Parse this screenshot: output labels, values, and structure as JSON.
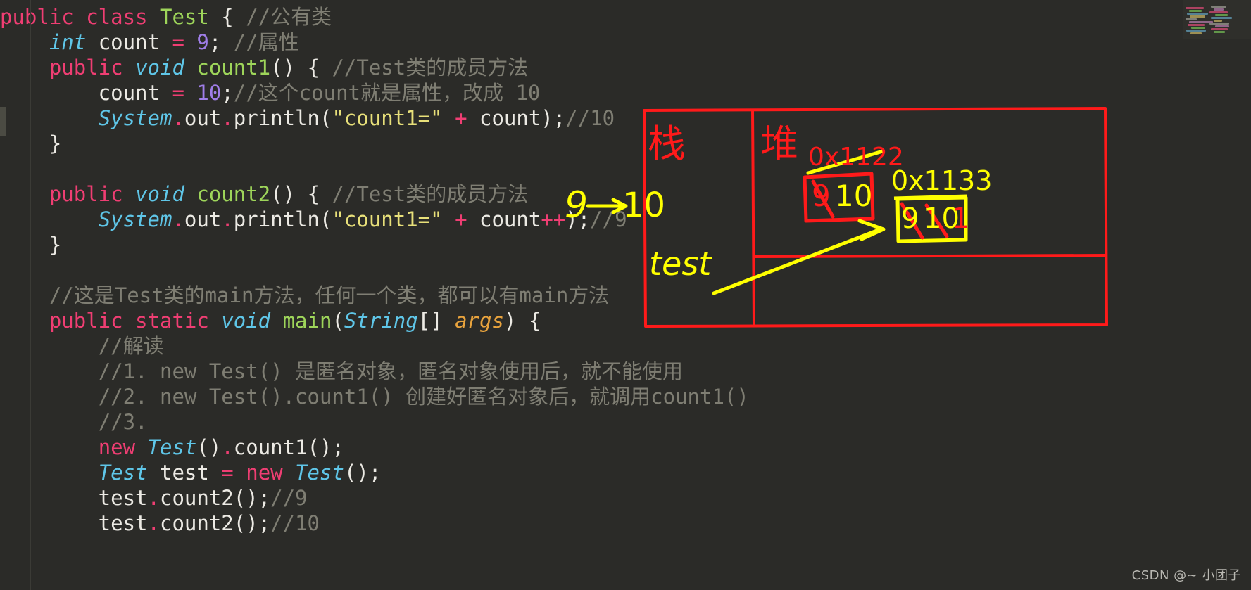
{
  "editor": {
    "background": "#2b2b28",
    "lines": [
      [
        {
          "t": "public class ",
          "c": "kw"
        },
        {
          "t": "Test",
          "c": "cls"
        },
        {
          "t": " { ",
          "c": "plain"
        },
        {
          "t": "//公有类",
          "c": "cmt"
        }
      ],
      [
        {
          "t": "    ",
          "c": "plain"
        },
        {
          "t": "int",
          "c": "type"
        },
        {
          "t": " count ",
          "c": "plain"
        },
        {
          "t": "=",
          "c": "op"
        },
        {
          "t": " ",
          "c": "plain"
        },
        {
          "t": "9",
          "c": "num"
        },
        {
          "t": "; ",
          "c": "plain"
        },
        {
          "t": "//属性",
          "c": "cmt"
        }
      ],
      [
        {
          "t": "    ",
          "c": "plain"
        },
        {
          "t": "public ",
          "c": "kw"
        },
        {
          "t": "void",
          "c": "type"
        },
        {
          "t": " ",
          "c": "plain"
        },
        {
          "t": "count1",
          "c": "cls"
        },
        {
          "t": "() { ",
          "c": "plain"
        },
        {
          "t": "//Test类的成员方法",
          "c": "cmt"
        }
      ],
      [
        {
          "t": "        count ",
          "c": "plain"
        },
        {
          "t": "=",
          "c": "op"
        },
        {
          "t": " ",
          "c": "plain"
        },
        {
          "t": "10",
          "c": "num"
        },
        {
          "t": ";",
          "c": "plain"
        },
        {
          "t": "//这个count就是属性，改成 10",
          "c": "cmt"
        }
      ],
      [
        {
          "t": "        ",
          "c": "plain"
        },
        {
          "t": "System",
          "c": "type"
        },
        {
          "t": ".",
          "c": "op"
        },
        {
          "t": "out",
          "c": "plain"
        },
        {
          "t": ".",
          "c": "op"
        },
        {
          "t": "println(",
          "c": "plain"
        },
        {
          "t": "\"count1=\"",
          "c": "str"
        },
        {
          "t": " ",
          "c": "plain"
        },
        {
          "t": "+",
          "c": "op"
        },
        {
          "t": " count);",
          "c": "plain"
        },
        {
          "t": "//10",
          "c": "cmt"
        }
      ],
      [
        {
          "t": "    }",
          "c": "plain"
        }
      ],
      [
        {
          "t": "",
          "c": "plain"
        }
      ],
      [
        {
          "t": "    ",
          "c": "plain"
        },
        {
          "t": "public ",
          "c": "kw"
        },
        {
          "t": "void",
          "c": "type"
        },
        {
          "t": " ",
          "c": "plain"
        },
        {
          "t": "count2",
          "c": "cls"
        },
        {
          "t": "() { ",
          "c": "plain"
        },
        {
          "t": "//Test类的成员方法",
          "c": "cmt"
        }
      ],
      [
        {
          "t": "        ",
          "c": "plain"
        },
        {
          "t": "System",
          "c": "type"
        },
        {
          "t": ".",
          "c": "op"
        },
        {
          "t": "out",
          "c": "plain"
        },
        {
          "t": ".",
          "c": "op"
        },
        {
          "t": "println(",
          "c": "plain"
        },
        {
          "t": "\"count1=\"",
          "c": "str"
        },
        {
          "t": " ",
          "c": "plain"
        },
        {
          "t": "+",
          "c": "op"
        },
        {
          "t": " count",
          "c": "plain"
        },
        {
          "t": "++",
          "c": "op"
        },
        {
          "t": ");",
          "c": "plain"
        },
        {
          "t": "//9",
          "c": "cmt"
        }
      ],
      [
        {
          "t": "    }",
          "c": "plain"
        }
      ],
      [
        {
          "t": "",
          "c": "plain"
        }
      ],
      [
        {
          "t": "    ",
          "c": "plain"
        },
        {
          "t": "//这是Test类的main方法，任何一个类，都可以有main方法",
          "c": "cmt"
        }
      ],
      [
        {
          "t": "    ",
          "c": "plain"
        },
        {
          "t": "public static ",
          "c": "kw"
        },
        {
          "t": "void",
          "c": "type"
        },
        {
          "t": " ",
          "c": "plain"
        },
        {
          "t": "main",
          "c": "cls"
        },
        {
          "t": "(",
          "c": "plain"
        },
        {
          "t": "String",
          "c": "type"
        },
        {
          "t": "[] ",
          "c": "plain"
        },
        {
          "t": "args",
          "c": "param"
        },
        {
          "t": ") {",
          "c": "plain"
        }
      ],
      [
        {
          "t": "        ",
          "c": "plain"
        },
        {
          "t": "//解读",
          "c": "cmt"
        }
      ],
      [
        {
          "t": "        ",
          "c": "plain"
        },
        {
          "t": "//1. new Test() 是匿名对象，匿名对象使用后，就不能使用",
          "c": "cmt"
        }
      ],
      [
        {
          "t": "        ",
          "c": "plain"
        },
        {
          "t": "//2. new Test().count1() 创建好匿名对象后，就调用count1()",
          "c": "cmt"
        }
      ],
      [
        {
          "t": "        ",
          "c": "plain"
        },
        {
          "t": "//3.",
          "c": "cmt"
        }
      ],
      [
        {
          "t": "        ",
          "c": "plain"
        },
        {
          "t": "new",
          "c": "kw"
        },
        {
          "t": " ",
          "c": "plain"
        },
        {
          "t": "Test",
          "c": "type"
        },
        {
          "t": "()",
          "c": "plain"
        },
        {
          "t": ".",
          "c": "op"
        },
        {
          "t": "count1();",
          "c": "plain"
        }
      ],
      [
        {
          "t": "        ",
          "c": "plain"
        },
        {
          "t": "Test",
          "c": "type"
        },
        {
          "t": " test ",
          "c": "plain"
        },
        {
          "t": "=",
          "c": "op"
        },
        {
          "t": " ",
          "c": "plain"
        },
        {
          "t": "new",
          "c": "kw"
        },
        {
          "t": " ",
          "c": "plain"
        },
        {
          "t": "Test",
          "c": "type"
        },
        {
          "t": "();",
          "c": "plain"
        }
      ],
      [
        {
          "t": "        test",
          "c": "plain"
        },
        {
          "t": ".",
          "c": "op"
        },
        {
          "t": "count2();",
          "c": "plain"
        },
        {
          "t": "//9",
          "c": "cmt"
        }
      ],
      [
        {
          "t": "        test",
          "c": "plain"
        },
        {
          "t": ".",
          "c": "op"
        },
        {
          "t": "count2();",
          "c": "plain"
        },
        {
          "t": "//10",
          "c": "cmt"
        }
      ]
    ]
  },
  "annotations": {
    "inline_9_to_10": "9",
    "inline_arrow_target": "10",
    "stack_label": "栈",
    "heap_label": "堆",
    "stack_var": "test",
    "heap_addr_1": "0x1122",
    "heap_addr_2": "0x1133",
    "box1_old_value": "9",
    "box1_new_value": "10",
    "box2_value_a": "9",
    "box2_value_b": "10",
    "box2_value_c": "1",
    "colors": {
      "red": "#ff1a1a",
      "yellow": "#ffff00"
    }
  },
  "watermark": {
    "text": "CSDN @~ 小团子"
  },
  "minimap": {
    "label": "code-minimap"
  }
}
